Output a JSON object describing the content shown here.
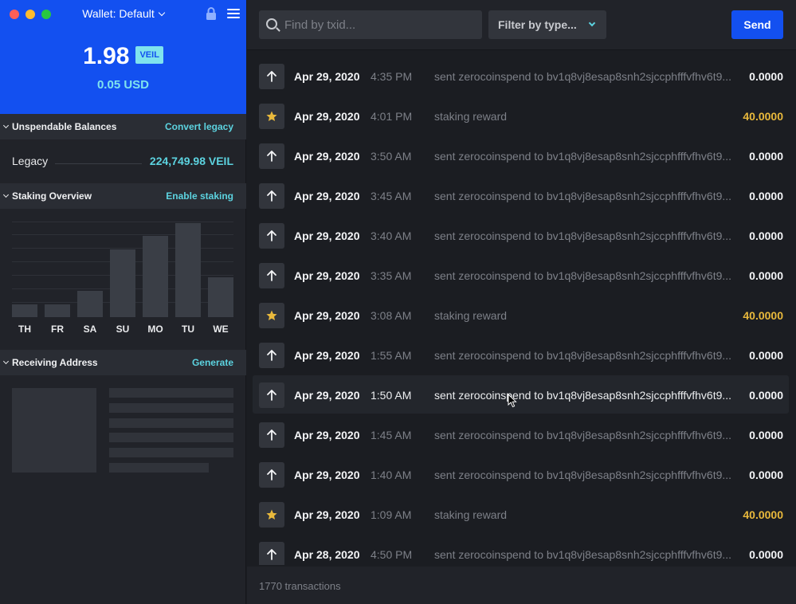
{
  "window": {
    "title": "Wallet: Default",
    "colors": {
      "accent": "#1350f0",
      "teal": "#5cd3e0",
      "reward": "#e9b93c"
    }
  },
  "balance": {
    "amount": "1.98",
    "unit": "VEIL",
    "usd": "0.05 USD"
  },
  "unspendable": {
    "title": "Unspendable Balances",
    "action": "Convert legacy",
    "legacy_label": "Legacy",
    "legacy_value": "224,749.98 VEIL"
  },
  "staking": {
    "title": "Staking Overview",
    "action": "Enable staking"
  },
  "chart_data": {
    "type": "bar",
    "categories": [
      "TH",
      "FR",
      "SA",
      "SU",
      "MO",
      "TU",
      "WE"
    ],
    "values": [
      16,
      16,
      33,
      85,
      102,
      118,
      50
    ],
    "ylim": [
      0,
      120
    ],
    "grid": true
  },
  "receiving": {
    "title": "Receiving Address",
    "action": "Generate"
  },
  "search": {
    "placeholder": "Find by txid..."
  },
  "filter": {
    "label": "Filter by type..."
  },
  "send_label": "Send",
  "transactions": [
    {
      "type": "sent",
      "date": "Apr 29, 2020",
      "time": "4:35 PM",
      "desc": "sent zerocoinspend to bv1q8vj8esap8snh2sjccphfffvfhv6t9...",
      "amount": "0.0000"
    },
    {
      "type": "reward",
      "date": "Apr 29, 2020",
      "time": "4:01 PM",
      "desc": "staking reward",
      "amount": "40.0000"
    },
    {
      "type": "sent",
      "date": "Apr 29, 2020",
      "time": "3:50 AM",
      "desc": "sent zerocoinspend to bv1q8vj8esap8snh2sjccphfffvfhv6t9...",
      "amount": "0.0000"
    },
    {
      "type": "sent",
      "date": "Apr 29, 2020",
      "time": "3:45 AM",
      "desc": "sent zerocoinspend to bv1q8vj8esap8snh2sjccphfffvfhv6t9...",
      "amount": "0.0000"
    },
    {
      "type": "sent",
      "date": "Apr 29, 2020",
      "time": "3:40 AM",
      "desc": "sent zerocoinspend to bv1q8vj8esap8snh2sjccphfffvfhv6t9...",
      "amount": "0.0000"
    },
    {
      "type": "sent",
      "date": "Apr 29, 2020",
      "time": "3:35 AM",
      "desc": "sent zerocoinspend to bv1q8vj8esap8snh2sjccphfffvfhv6t9...",
      "amount": "0.0000"
    },
    {
      "type": "reward",
      "date": "Apr 29, 2020",
      "time": "3:08 AM",
      "desc": "staking reward",
      "amount": "40.0000"
    },
    {
      "type": "sent",
      "date": "Apr 29, 2020",
      "time": "1:55 AM",
      "desc": "sent zerocoinspend to bv1q8vj8esap8snh2sjccphfffvfhv6t9...",
      "amount": "0.0000"
    },
    {
      "type": "sent",
      "date": "Apr 29, 2020",
      "time": "1:50 AM",
      "desc": "sent zerocoinspend to bv1q8vj8esap8snh2sjccphfffvfhv6t9...",
      "amount": "0.0000",
      "hover": true
    },
    {
      "type": "sent",
      "date": "Apr 29, 2020",
      "time": "1:45 AM",
      "desc": "sent zerocoinspend to bv1q8vj8esap8snh2sjccphfffvfhv6t9...",
      "amount": "0.0000"
    },
    {
      "type": "sent",
      "date": "Apr 29, 2020",
      "time": "1:40 AM",
      "desc": "sent zerocoinspend to bv1q8vj8esap8snh2sjccphfffvfhv6t9...",
      "amount": "0.0000"
    },
    {
      "type": "reward",
      "date": "Apr 29, 2020",
      "time": "1:09 AM",
      "desc": "staking reward",
      "amount": "40.0000"
    },
    {
      "type": "sent",
      "date": "Apr 28, 2020",
      "time": "4:50 PM",
      "desc": "sent zerocoinspend to bv1q8vj8esap8snh2sjccphfffvfhv6t9...",
      "amount": "0.0000"
    }
  ],
  "footer": {
    "count": "1770 transactions"
  }
}
